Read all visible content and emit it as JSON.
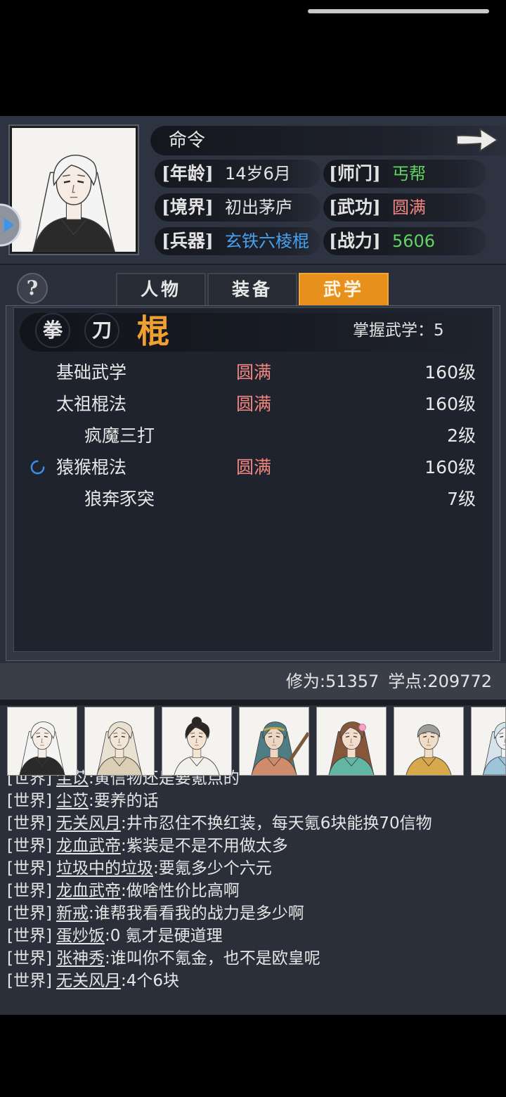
{
  "hero": {
    "portrait_icon": "white-haired-hero-portrait",
    "command": "命令",
    "next_icon": "arrow-right-icon",
    "side_button_icon": "play-triangle-icon",
    "fields": [
      {
        "label": "[年龄]",
        "value": "14岁6月",
        "color": "#e4e4e4"
      },
      {
        "label": "[师门]",
        "value": "丐帮",
        "color": "#5fd45f"
      },
      {
        "label": "[境界]",
        "value": "初出茅庐",
        "color": "#e4e4e4"
      },
      {
        "label": "[武功]",
        "value": "圆满",
        "color": "#f2867f"
      },
      {
        "label": "[兵器]",
        "value": "玄铁六棱棍",
        "color": "#47a1ee"
      },
      {
        "label": "[战力]",
        "value": "5606",
        "color": "#5fd45f"
      }
    ]
  },
  "help": {
    "glyph": "?",
    "icon": "question-icon"
  },
  "tabs": [
    {
      "label": "人物",
      "active": false
    },
    {
      "label": "装备",
      "active": false
    },
    {
      "label": "武学",
      "active": true
    }
  ],
  "weapon_filter": {
    "types": [
      {
        "label": "拳",
        "active": false
      },
      {
        "label": "刀",
        "active": false
      },
      {
        "label": "棍",
        "active": true
      }
    ],
    "mastered": "掌握武学：5"
  },
  "skills": [
    {
      "name": "基础武学",
      "status": "圆满",
      "level": "160级"
    },
    {
      "name": "太祖棍法",
      "status": "圆满",
      "level": "160级"
    },
    {
      "name": "疯魔三打",
      "level": "2级",
      "sub": true
    },
    {
      "name": "猿猴棍法",
      "status": "圆满",
      "level": "160级",
      "training": true
    },
    {
      "name": "狼奔豕突",
      "level": "7级",
      "sub": true
    }
  ],
  "stats": {
    "cultivation": "修为:51357",
    "study_points": "学点:209772"
  },
  "team_portraits": [
    "white-haired-hero-portrait",
    "silver-haired-scholar-portrait",
    "young-girl-portrait",
    "headband-warrior-portrait",
    "flower-maiden-portrait",
    "monk-portrait",
    "blue-robed-figure-portrait"
  ],
  "chat": {
    "messages": [
      {
        "channel": "[世界]",
        "user": "尘苡",
        "text": ":黄信物还是要氪点的"
      },
      {
        "channel": "[世界]",
        "user": "尘苡",
        "text": ":要养的话"
      },
      {
        "channel": "[世界]",
        "user": "无关风月",
        "text": ":井市忍住不换红装，每天氪6块能换70信物"
      },
      {
        "channel": "[世界]",
        "user": "龙血武帝",
        "text": ":紫装是不是不用做太多"
      },
      {
        "channel": "[世界]",
        "user": "垃圾中的垃圾",
        "text": ":要氪多少个六元"
      },
      {
        "channel": "[世界]",
        "user": "龙血武帝",
        "text": ":做啥性价比高啊"
      },
      {
        "channel": "[世界]",
        "user": "新戒",
        "text": ":谁帮我看看我的战力是多少啊"
      },
      {
        "channel": "[世界]",
        "user": "蛋炒饭",
        "text": ":0 氪才是硬道理"
      },
      {
        "channel": "[世界]",
        "user": "张神秀",
        "text": ":谁叫你不氪金，也不是欧皇呢"
      },
      {
        "channel": "[世界]",
        "user": "无关风月",
        "text": ":4个6块"
      }
    ]
  },
  "icons": {
    "training": "loading-spinner-icon",
    "home_indicator": "home-indicator"
  },
  "colors": {
    "accent": "#e8901c",
    "active_weapon": "#f0a030",
    "status_full": "#f2867f",
    "green": "#5fd45f",
    "blue": "#47a1ee",
    "panel": "#2b2f3b"
  }
}
